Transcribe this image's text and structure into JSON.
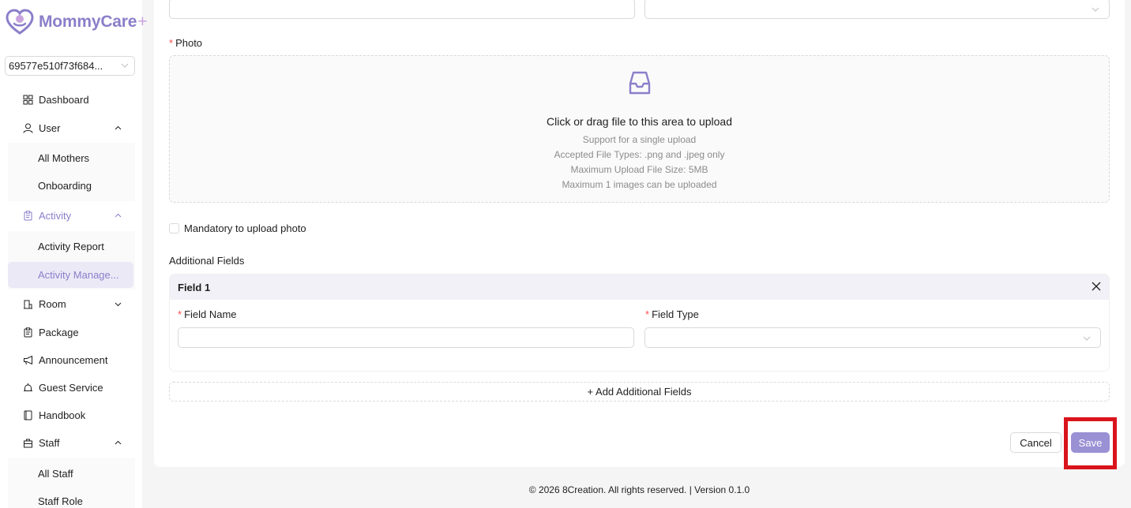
{
  "app": {
    "logo_text": "MommyCare",
    "logo_plus": "+"
  },
  "sidebar": {
    "org_selector_value": "69577e510f73f684...",
    "items": [
      {
        "label": "Dashboard",
        "icon": "grid-icon"
      },
      {
        "label": "User",
        "icon": "user-icon",
        "expanded": true
      },
      {
        "label": "All Mothers"
      },
      {
        "label": "Onboarding"
      },
      {
        "label": "Activity",
        "icon": "clipboard-icon",
        "expanded": true
      },
      {
        "label": "Activity Report"
      },
      {
        "label": "Activity Manage..."
      },
      {
        "label": "Room",
        "icon": "room-icon",
        "expanded": false
      },
      {
        "label": "Package",
        "icon": "package-icon"
      },
      {
        "label": "Announcement",
        "icon": "megaphone-icon"
      },
      {
        "label": "Guest Service",
        "icon": "bell-icon"
      },
      {
        "label": "Handbook",
        "icon": "book-icon"
      },
      {
        "label": "Staff",
        "icon": "staff-icon",
        "expanded": true
      },
      {
        "label": "All Staff"
      },
      {
        "label": "Staff Role"
      }
    ]
  },
  "form": {
    "photo_label": "Photo",
    "upload": {
      "title": "Click or drag file to this area to upload",
      "lines": [
        "Support for a single upload",
        "Accepted File Types: .png and .jpeg only",
        "Maximum Upload File Size: 5MB",
        "Maximum 1 images can be uploaded"
      ]
    },
    "mandatory_photo_label": "Mandatory to upload photo",
    "mandatory_photo_checked": false,
    "additional_fields_label": "Additional Fields",
    "field_panel": {
      "title": "Field 1",
      "field_name_label": "Field Name",
      "field_name_value": "",
      "field_type_label": "Field Type",
      "field_type_value": ""
    },
    "add_fields_button": "+ Add Additional Fields",
    "cancel_button": "Cancel",
    "save_button": "Save"
  },
  "footer": {
    "text": "© 2026 8Creation. All rights reserved. | Version 0.1.0"
  },
  "colors": {
    "brand": "#8a7fc9",
    "primary_button": "#9a90d4",
    "required": "#ff4d4f",
    "highlight": "#d9141b"
  }
}
